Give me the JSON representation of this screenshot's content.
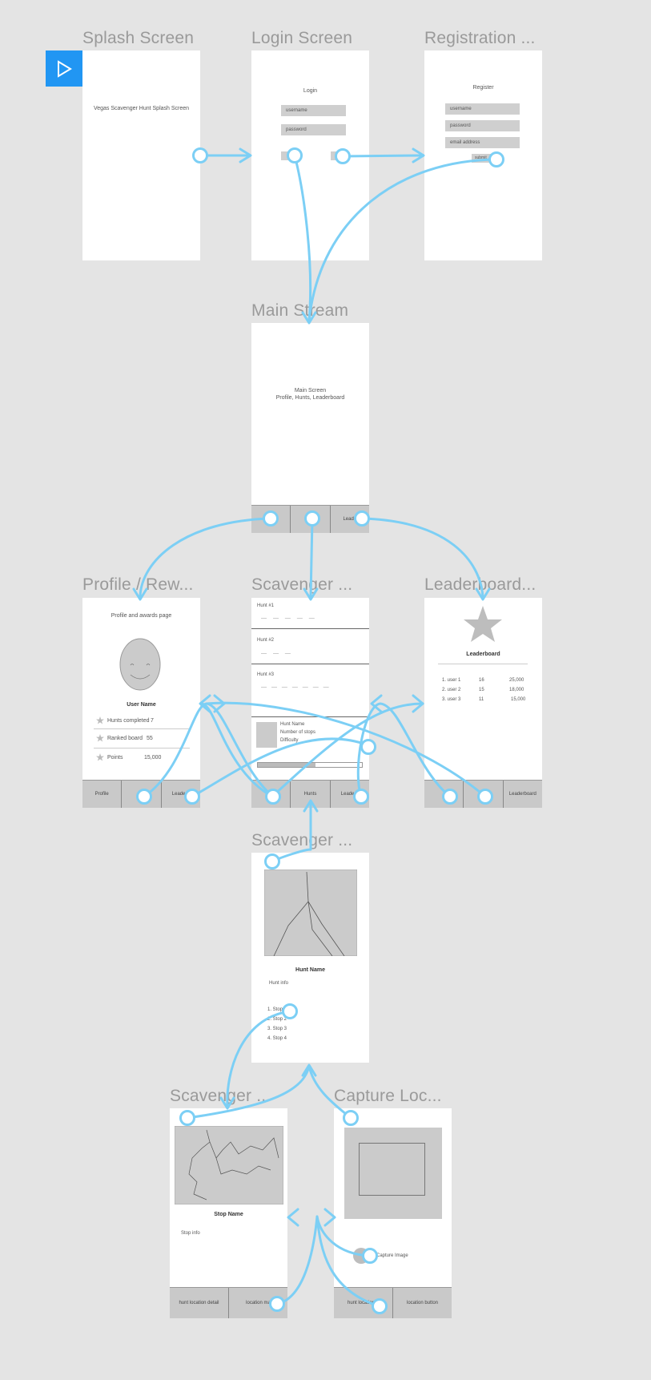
{
  "play_button": {
    "icon": "play-icon",
    "color": "#2196f3"
  },
  "link_color": "#7ccff5",
  "screens": {
    "splash": {
      "title": "Splash Screen",
      "text": "Vegas Scavenger Hunt Splash Screen"
    },
    "login": {
      "title": "Login Screen",
      "heading": "Login",
      "username": "username",
      "password": "password"
    },
    "registration": {
      "title": "Registration ...",
      "heading": "Register",
      "username": "username",
      "password": "password",
      "email": "email address",
      "submit": "submit"
    },
    "main": {
      "title": "Main Stream",
      "line1": "Main Screen",
      "line2": "Profile, Hunts, Leaderboard",
      "tabs": [
        "",
        "",
        "Leade"
      ]
    },
    "profile": {
      "title": "Profile / Rew...",
      "heading": "Profile and awards page",
      "user_name": "User Name",
      "stats": [
        {
          "label": "Hunts completed",
          "value": "7"
        },
        {
          "label": "Ranked board",
          "value": "55"
        },
        {
          "label": "Points",
          "value": "15,000"
        }
      ],
      "tabs": [
        "Profile",
        "",
        "Leaderb"
      ]
    },
    "hunts": {
      "title": "Scavenger ...",
      "items": [
        "Hunt #1",
        "Hunt #2",
        "Hunt #3"
      ],
      "detail_lines": [
        "Hunt Name",
        "Number of stops",
        "Difficulty"
      ],
      "tabs": [
        "",
        "Hunts",
        "Leaderb"
      ]
    },
    "leaderboard": {
      "title": "Leaderboard...",
      "heading": "Leaderboard",
      "rows": [
        {
          "rank": "1. user 1",
          "hunts": "16",
          "points": "25,000"
        },
        {
          "rank": "2. user 2",
          "hunts": "15",
          "points": "18,000"
        },
        {
          "rank": "3. user 3",
          "hunts": "11",
          "points": "15,000"
        }
      ],
      "tabs": [
        "",
        "",
        "Leaderboard"
      ]
    },
    "hunt_detail": {
      "title": "Scavenger ...",
      "name": "Hunt Name",
      "info": "Hunt info",
      "stops": [
        "1. Stop 1",
        "2. Stop 2",
        "3. Stop 3",
        "4. Stop 4"
      ]
    },
    "stop_detail": {
      "title": "Scavenger ...",
      "name": "Stop Name",
      "info": "Stop info",
      "tabs": [
        "hunt location detail",
        "location ma"
      ]
    },
    "capture": {
      "title": "Capture Loc...",
      "capture_label": "Capture Image",
      "tabs": [
        "hunt location d",
        "location button"
      ]
    }
  }
}
